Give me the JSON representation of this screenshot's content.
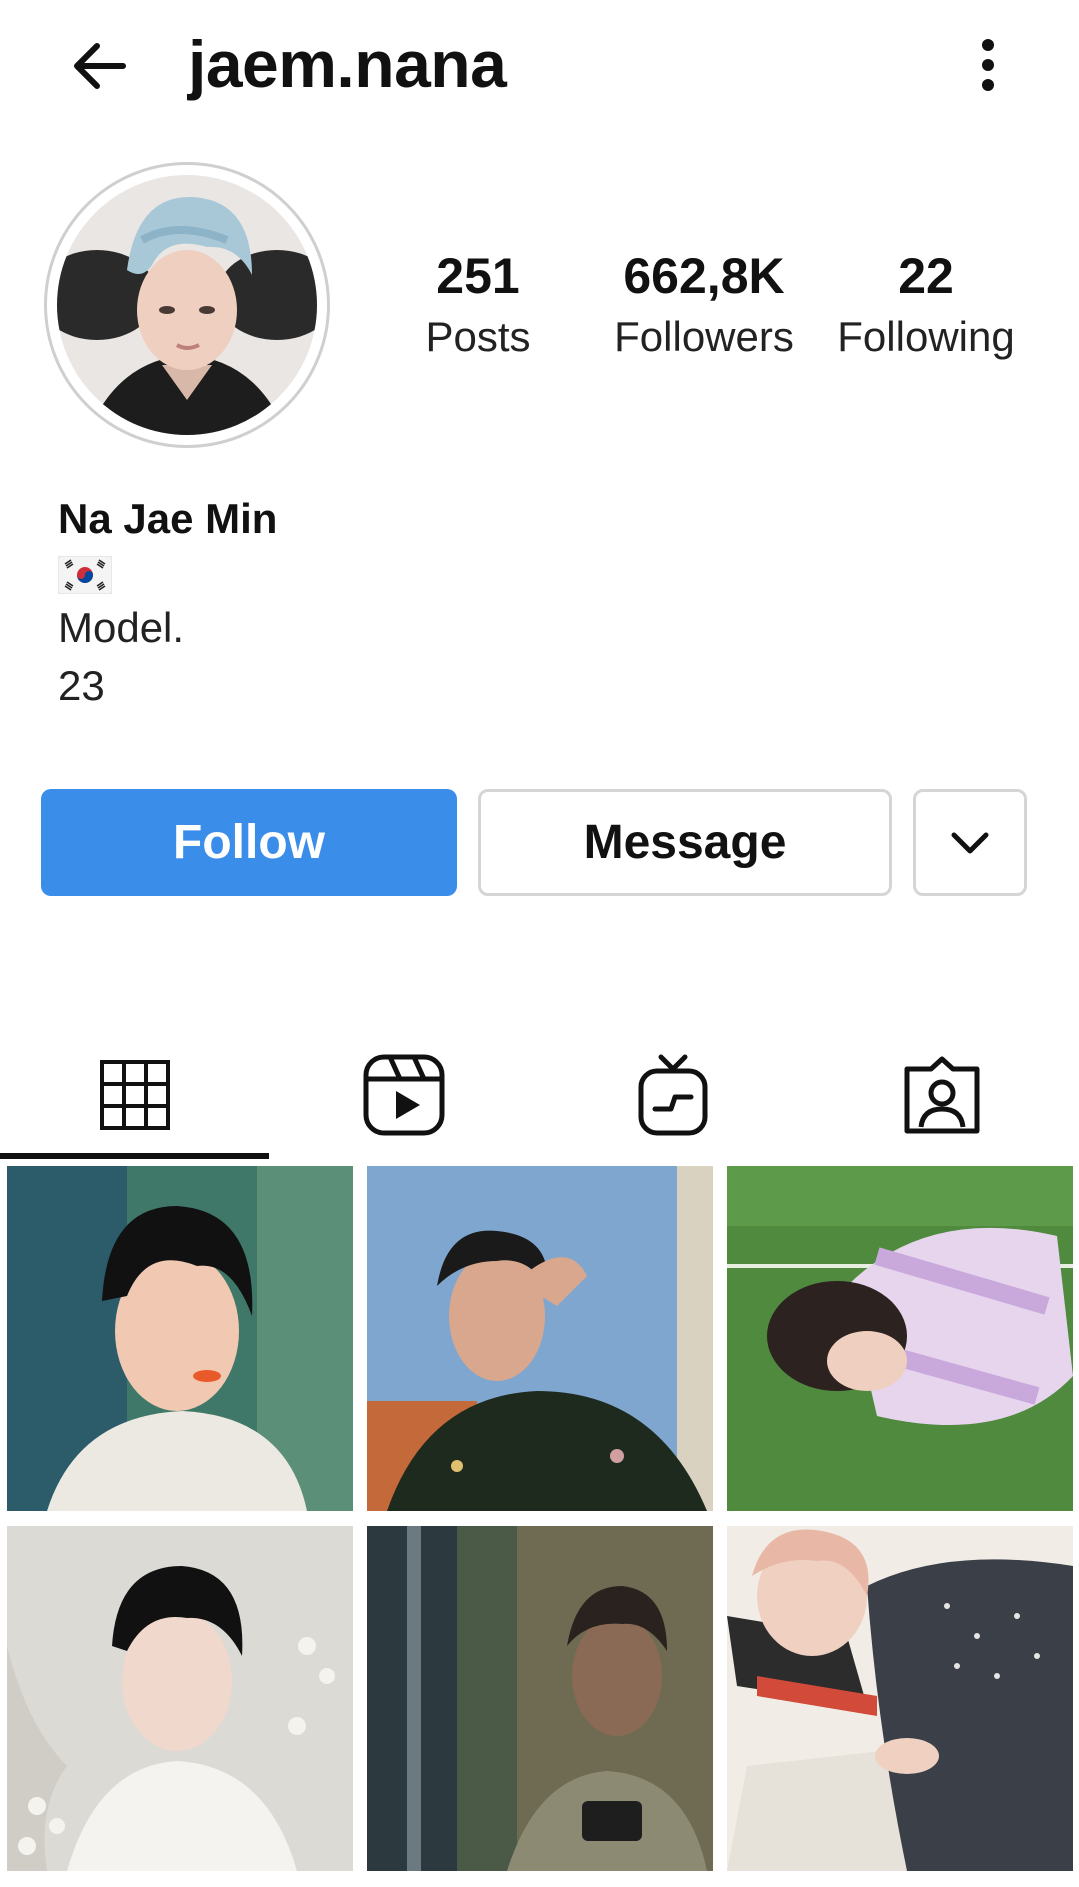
{
  "header": {
    "username": "jaem.nana",
    "back_icon": "arrow-left-icon",
    "more_icon": "more-vertical-icon"
  },
  "profile": {
    "stats": [
      {
        "value": "251",
        "label": "Posts"
      },
      {
        "value": "662,8K",
        "label": "Followers"
      },
      {
        "value": "22",
        "label": "Following"
      }
    ],
    "bio": {
      "name": "Na Jae Min",
      "flag_icon": "south-korea-flag-icon",
      "line1": "Model.",
      "line2": "23"
    }
  },
  "actions": {
    "follow_label": "Follow",
    "message_label": "Message",
    "dropdown_icon": "chevron-down-icon"
  },
  "colors": {
    "follow_button": "#3a8eea",
    "border": "#d5d5d5",
    "text": "#111111"
  },
  "tabs": [
    {
      "icon": "grid-icon",
      "active": true
    },
    {
      "icon": "reels-icon",
      "active": false
    },
    {
      "icon": "igtv-icon",
      "active": false
    },
    {
      "icon": "tagged-icon",
      "active": false
    }
  ]
}
